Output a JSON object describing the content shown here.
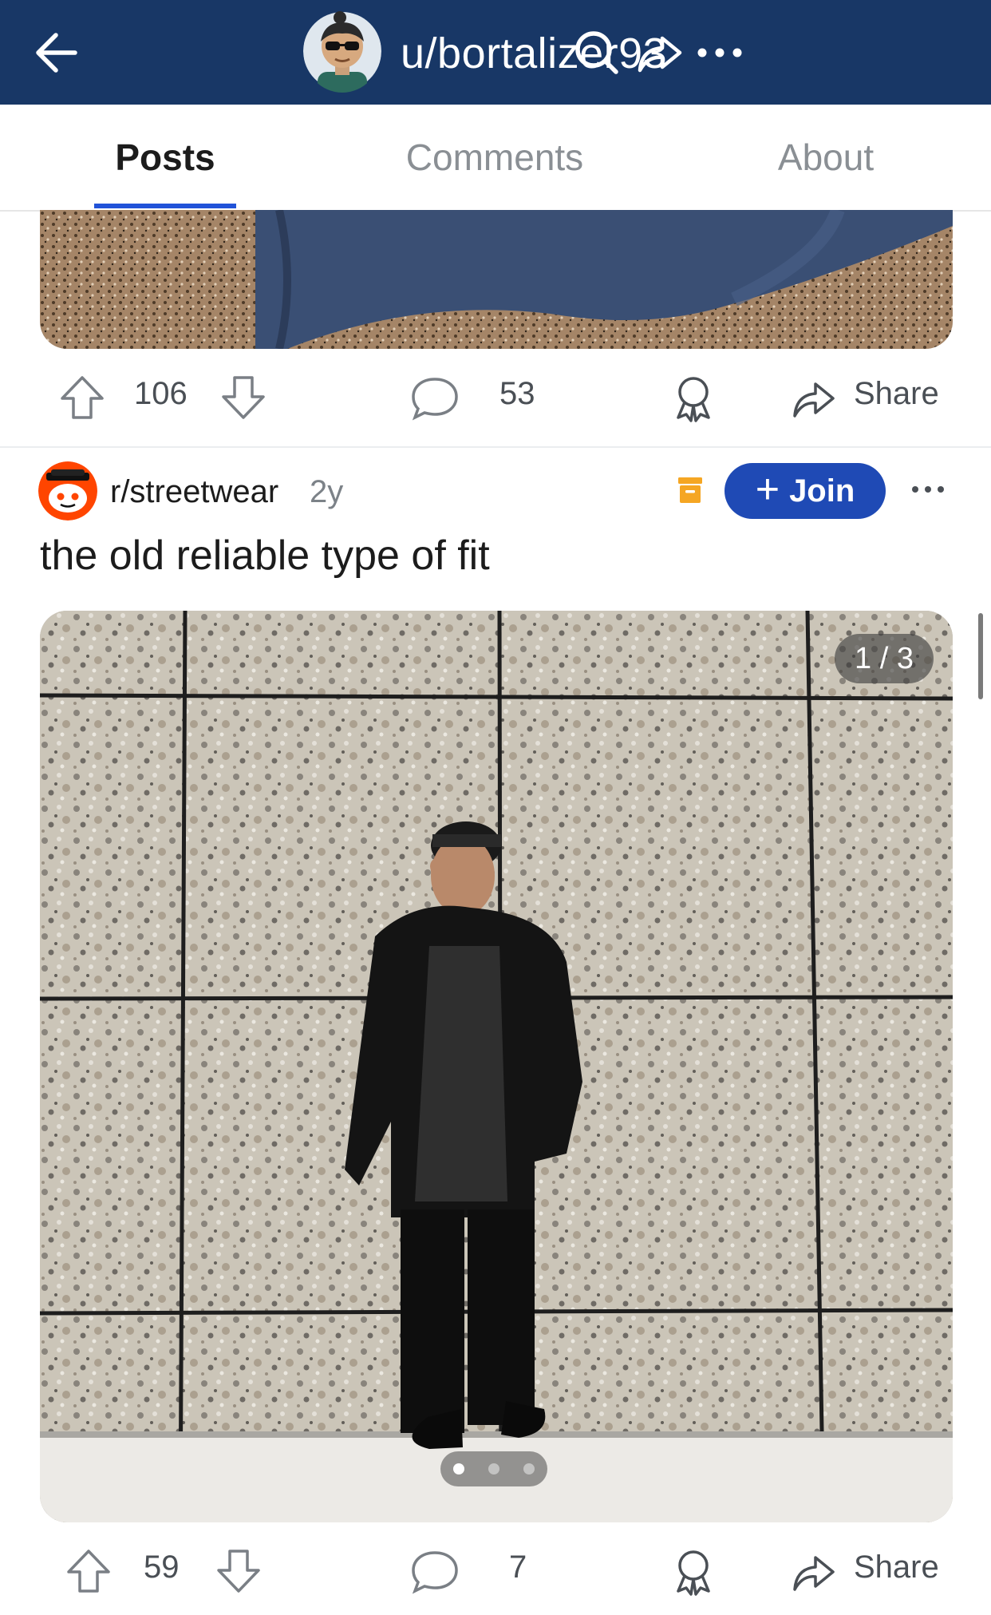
{
  "header": {
    "username": "u/bortalizer93"
  },
  "tabs": [
    {
      "label": "Posts"
    },
    {
      "label": "Comments"
    },
    {
      "label": "About"
    }
  ],
  "post1": {
    "upvotes": "106",
    "comments": "53",
    "share_label": "Share"
  },
  "post2": {
    "subreddit": "r/streetwear",
    "age": "2y",
    "join_label": "Join",
    "title": "the old reliable type of fit",
    "gallery_counter": "1 / 3",
    "upvotes": "59",
    "comments": "7",
    "share_label": "Share"
  },
  "colors": {
    "header_bg": "#183766",
    "accent": "#2153d8",
    "join_button": "#1f4ab5",
    "archive_icon": "#f5a623"
  },
  "icons": [
    "back-arrow-icon",
    "search-icon",
    "share-icon",
    "more-icon",
    "upvote-icon",
    "downvote-icon",
    "comment-icon",
    "award-icon",
    "archive-icon"
  ]
}
